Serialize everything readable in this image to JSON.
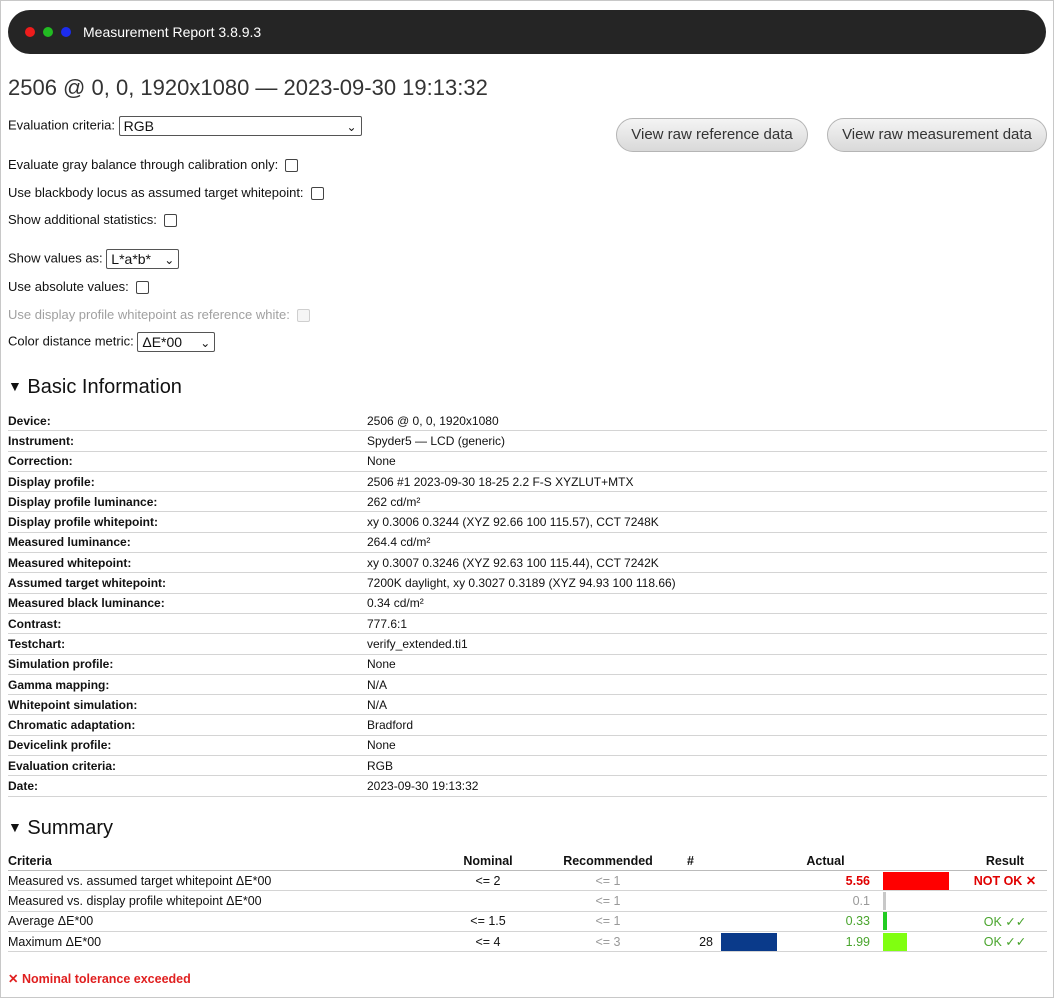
{
  "window": {
    "title": "Measurement Report 3.8.9.3",
    "dot_colors": [
      "#ee1c1c",
      "#22bb22",
      "#1c2cee"
    ]
  },
  "page": {
    "heading": "2506 @ 0, 0, 1920x1080 — 2023-09-30 19:13:32"
  },
  "controls": {
    "evaluation_criteria_label": "Evaluation criteria:",
    "evaluation_criteria_value": "RGB",
    "gray_balance_label": "Evaluate gray balance through calibration only:",
    "blackbody_label": "Use blackbody locus as assumed target whitepoint:",
    "additional_stats_label": "Show additional statistics:",
    "show_values_label": "Show values as:",
    "show_values_value": "L*a*b*",
    "absolute_values_label": "Use absolute values:",
    "profile_whitepoint_label": "Use display profile whitepoint as reference white:",
    "color_metric_label": "Color distance metric:",
    "color_metric_value": "ΔE*00"
  },
  "buttons": {
    "raw_reference": "View raw reference data",
    "raw_measurement": "View raw measurement data"
  },
  "basic_information": {
    "title": "Basic Information",
    "rows": [
      {
        "key": "Device:",
        "value": "2506 @ 0, 0, 1920x1080"
      },
      {
        "key": "Instrument:",
        "value": "Spyder5 — LCD (generic)"
      },
      {
        "key": "Correction:",
        "value": "None"
      },
      {
        "key": "Display profile:",
        "value": "2506 #1 2023-09-30 18-25 2.2 F-S XYZLUT+MTX"
      },
      {
        "key": "Display profile luminance:",
        "value": "262 cd/m²"
      },
      {
        "key": "Display profile whitepoint:",
        "value": "xy 0.3006 0.3244 (XYZ 92.66 100 115.57), CCT 7248K"
      },
      {
        "key": "Measured luminance:",
        "value": "264.4 cd/m²"
      },
      {
        "key": "Measured whitepoint:",
        "value": "xy 0.3007 0.3246 (XYZ 92.63 100 115.44), CCT 7242K"
      },
      {
        "key": "Assumed target whitepoint:",
        "value": "7200K daylight, xy 0.3027 0.3189 (XYZ 94.93 100 118.66)"
      },
      {
        "key": "Measured black luminance:",
        "value": "0.34 cd/m²"
      },
      {
        "key": "Contrast:",
        "value": "777.6:1"
      },
      {
        "key": "Testchart:",
        "value": "verify_extended.ti1"
      },
      {
        "key": "Simulation profile:",
        "value": "None"
      },
      {
        "key": "Gamma mapping:",
        "value": "N/A"
      },
      {
        "key": "Whitepoint simulation:",
        "value": "N/A"
      },
      {
        "key": "Chromatic adaptation:",
        "value": "Bradford"
      },
      {
        "key": "Devicelink profile:",
        "value": "None"
      },
      {
        "key": "Evaluation criteria:",
        "value": "RGB"
      },
      {
        "key": "Date:",
        "value": "2023-09-30 19:13:32"
      }
    ]
  },
  "summary": {
    "title": "Summary",
    "headers": {
      "criteria": "Criteria",
      "nominal": "Nominal",
      "recommended": "Recommended",
      "count": "#",
      "actual": "Actual",
      "result": "Result"
    },
    "rows": [
      {
        "criteria": "Measured vs. assumed target whitepoint ΔE*00",
        "nominal": "<= 2",
        "recommended": "<= 1",
        "count": "",
        "count_bar_fraction": 0,
        "actual": "5.56",
        "actual_bar_fraction": 1.0,
        "actual_bar_color": "#ff0000",
        "actual_color": "#e00000",
        "result": "NOT OK ✕",
        "result_color": "#e00000"
      },
      {
        "criteria": "Measured vs. display profile whitepoint ΔE*00",
        "nominal": "",
        "recommended": "<= 1",
        "count": "",
        "count_bar_fraction": 0,
        "actual": "0.1",
        "actual_bar_fraction": 0.04,
        "actual_bar_color": "#c8c8c8",
        "actual_color": "#999999",
        "result": "",
        "result_color": "#4aa52e"
      },
      {
        "criteria": "Average ΔE*00",
        "nominal": "<= 1.5",
        "recommended": "<= 1",
        "count": "",
        "count_bar_fraction": 0,
        "actual": "0.33",
        "actual_bar_fraction": 0.06,
        "actual_bar_color": "#22cc22",
        "actual_color": "#4aa52e",
        "result": "OK ✓✓",
        "result_color": "#4aa52e"
      },
      {
        "criteria": "Maximum ΔE*00",
        "nominal": "<= 4",
        "recommended": "<= 3",
        "count": "28",
        "count_bar_fraction": 1.0,
        "actual": "1.99",
        "actual_bar_fraction": 0.36,
        "actual_bar_color": "#80ff10",
        "actual_color": "#4aa52e",
        "result": "OK ✓✓",
        "result_color": "#4aa52e"
      }
    ],
    "count_bar_color": "#0a3a8a",
    "note": "✕ Nominal tolerance exceeded"
  }
}
